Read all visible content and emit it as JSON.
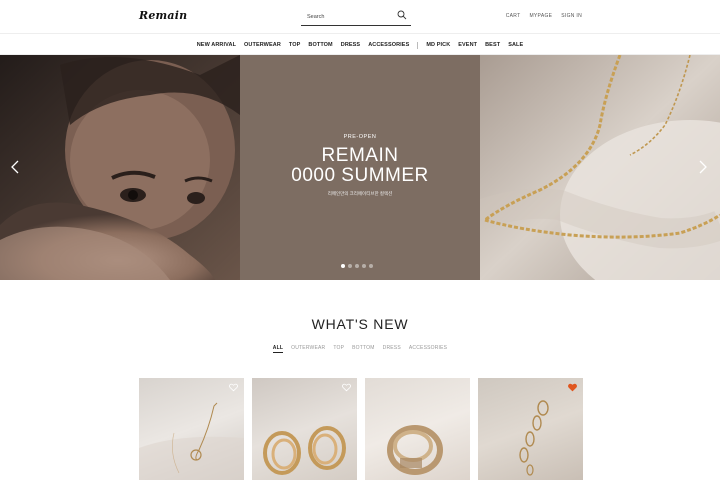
{
  "header": {
    "logo": "Remain",
    "search_placeholder": "Search",
    "utils": [
      "CART",
      "MYPAGE",
      "SIGN IN"
    ]
  },
  "nav": {
    "items": [
      "NEW ARRIVAL",
      "OUTERWEAR",
      "TOP",
      "BOTTOM",
      "DRESS",
      "ACCESSORIES"
    ],
    "items_right": [
      "MD PICK",
      "EVENT",
      "BEST",
      "SALE"
    ]
  },
  "hero": {
    "pre_open": "PRE-OPEN",
    "title_line1": "REMAIN",
    "title_line2": "0000 SUMMER",
    "subtitle": "리메인만의 크리에이티브한 컬렉션",
    "slide_count": 5,
    "active_slide": 1
  },
  "whats_new": {
    "title": "WHAT'S NEW",
    "categories": [
      "ALL",
      "OUTERWEAR",
      "TOP",
      "BOTTOM",
      "DRESS",
      "ACCESSORIES"
    ],
    "active_category": "ALL"
  },
  "products": [
    {
      "liked": false
    },
    {
      "liked": false
    },
    {
      "liked": false
    },
    {
      "liked": true
    }
  ],
  "colors": {
    "hero_center": "#7d6d62",
    "heart_active": "#e0561f",
    "text": "#222222"
  }
}
